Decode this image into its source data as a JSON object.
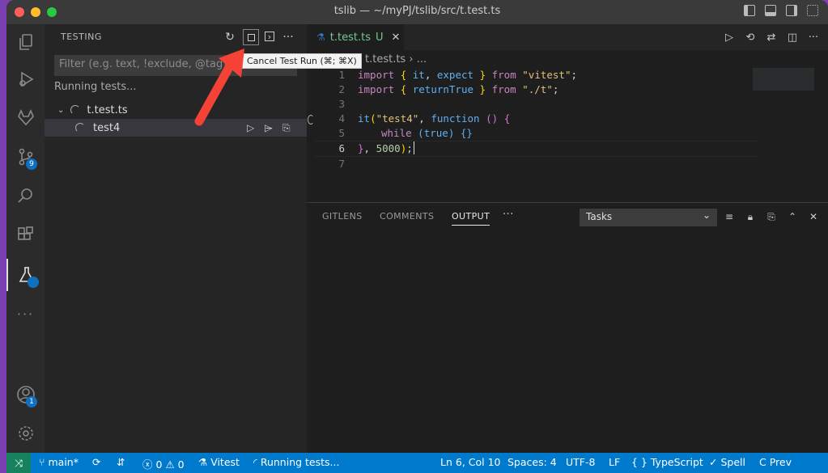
{
  "window": {
    "title": "tslib — ~/myPJ/tslib/src/t.test.ts"
  },
  "colors": {
    "accent": "#007acc",
    "remote": "#16825d",
    "close": "#ff5f57",
    "minimize": "#febc2e",
    "maximize": "#28c840",
    "arrow": "#f44336"
  },
  "activity_bar": {
    "items": [
      "explorer-icon",
      "run-debug-icon",
      "gitlab-icon",
      "source-control-icon",
      "search-icon",
      "extensions-icon",
      "testing-icon",
      "more-icon",
      "accounts-icon",
      "settings-icon"
    ],
    "source_control_badge": "9",
    "accounts_badge": "1"
  },
  "sidebar": {
    "title": "TESTING",
    "filter_placeholder": "Filter (e.g. text, !exclude, @tag)",
    "running_label": "Running tests...",
    "tree": [
      {
        "label": "t.test.ts"
      },
      {
        "label": "test4"
      }
    ]
  },
  "tooltip": {
    "text": "Cancel Test Run (⌘; ⌘X)"
  },
  "editor": {
    "tab": {
      "label": "t.test.ts",
      "status": "U"
    },
    "breadcrumb": {
      "file": "t.test.ts",
      "rest": "..."
    },
    "line_numbers": [
      "1",
      "2",
      "3",
      "4",
      "5",
      "6",
      "7"
    ],
    "code": {
      "l1": {
        "import": "import",
        "b1": "{",
        "it": "it",
        "comma": ",",
        "expect": "expect",
        "b2": "}",
        "from": "from",
        "src": "\"vitest\"",
        "semi": ";"
      },
      "l2": {
        "import": "import",
        "b1": "{",
        "returnTrue": "returnTrue",
        "b2": "}",
        "from": "from",
        "src": "\"./t\"",
        "semi": ";"
      },
      "l4": {
        "it": "it",
        "paren": "(",
        "name": "\"test4\"",
        "comma": ",",
        "function": "function",
        "args": "()",
        "brace": "{"
      },
      "l5": {
        "while": "while",
        "cond_open": "(",
        "cond": "true",
        "cond_close": ")",
        "block": "{}"
      },
      "l6": {
        "brace": "}",
        "comma": ",",
        "timeout": "5000",
        "close": ")",
        "semi": ";"
      }
    }
  },
  "panel": {
    "tabs": [
      "GITLENS",
      "COMMENTS",
      "OUTPUT"
    ],
    "more": "···",
    "select_value": "Tasks"
  },
  "statusbar": {
    "branch": "main*",
    "errors": "0",
    "warnings": "0",
    "vitest": "Vitest",
    "running": "Running tests...",
    "position": "Ln 6, Col 10",
    "spaces": "Spaces: 4",
    "encoding": "UTF-8",
    "eol": "LF",
    "language": "TypeScript",
    "spell": "Spell",
    "prev": "C Prev"
  }
}
